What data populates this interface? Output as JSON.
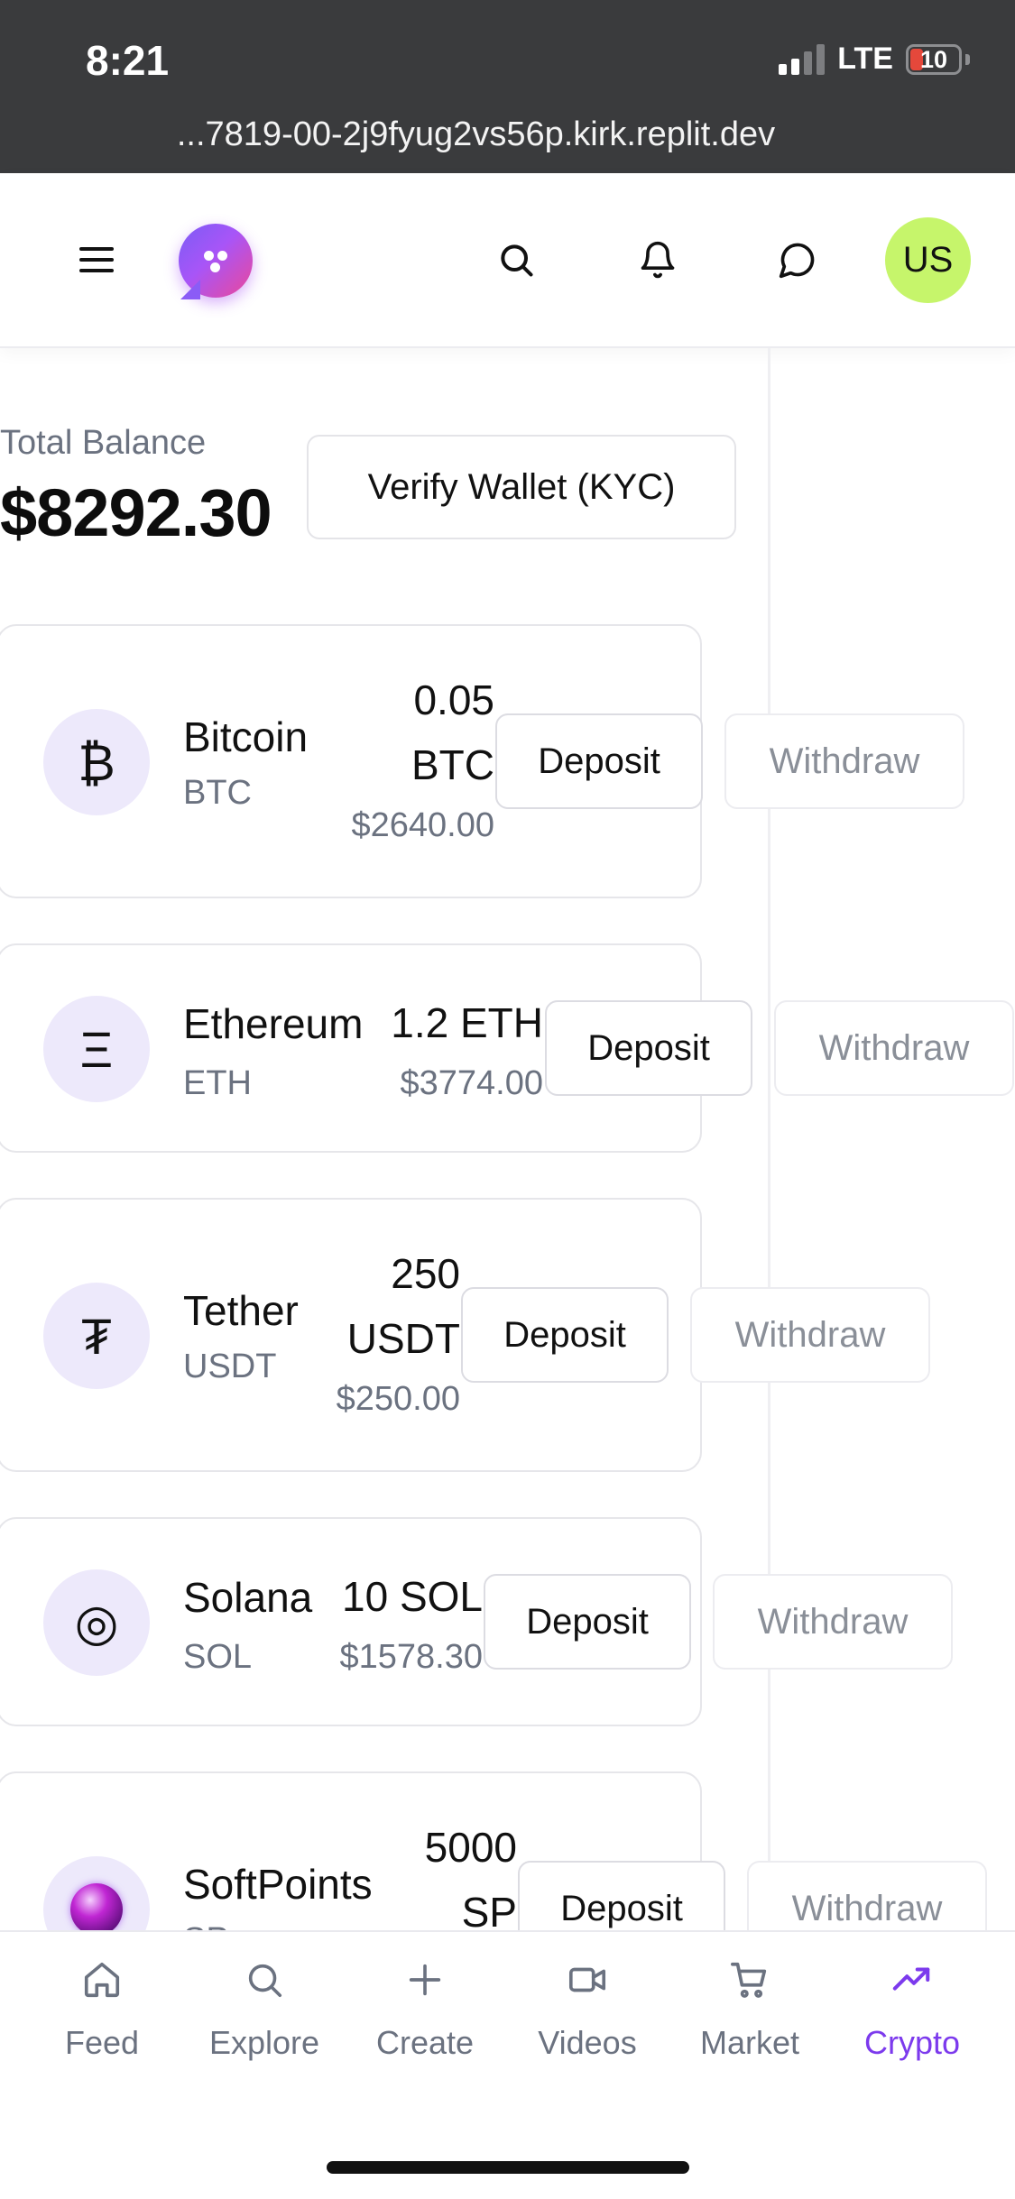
{
  "status_bar": {
    "time": "8:21",
    "network": "LTE",
    "battery": "10",
    "url": "...7819-00-2j9fyug2vs56p.kirk.replit.dev"
  },
  "header": {
    "menu_icon": "hamburger-icon",
    "logo_icon": "chat-bubble-logo",
    "search_icon": "search-icon",
    "notifications_icon": "bell-icon",
    "messages_icon": "message-circle-icon",
    "avatar_initials": "US",
    "avatar_color": "#c6f56b"
  },
  "wallet": {
    "balance_label": "Total Balance",
    "balance_value": "$8292.30",
    "kyc_button": "Verify Wallet (KYC)"
  },
  "assets": [
    {
      "name": "Bitcoin",
      "symbol": "BTC",
      "icon": "₿",
      "amount_line1": "0.05",
      "amount_line2": "BTC",
      "fiat": "$2640.00",
      "deposit": "Deposit",
      "withdraw": "Withdraw"
    },
    {
      "name": "Ethereum",
      "symbol": "ETH",
      "icon": "Ξ",
      "amount_line1": "1.2 ETH",
      "fiat": "$3774.00",
      "deposit": "Deposit",
      "withdraw": "Withdraw"
    },
    {
      "name": "Tether",
      "symbol": "USDT",
      "icon": "₮",
      "amount_line1": "250",
      "amount_line2": "USDT",
      "fiat": "$250.00",
      "deposit": "Deposit",
      "withdraw": "Withdraw"
    },
    {
      "name": "Solana",
      "symbol": "SOL",
      "icon": "◎",
      "amount_line1": "10 SOL",
      "fiat": "$1578.30",
      "deposit": "Deposit",
      "withdraw": "Withdraw"
    },
    {
      "name": "SoftPoints",
      "symbol": "SP",
      "icon": "purple-orb-icon",
      "amount_line1": "5000",
      "amount_line2": "SP",
      "deposit": "Deposit",
      "withdraw": "Withdraw"
    }
  ],
  "bottom_nav": {
    "active_color": "#7c3aed",
    "items": [
      {
        "label": "Feed",
        "icon": "home-icon"
      },
      {
        "label": "Explore",
        "icon": "search-icon"
      },
      {
        "label": "Create",
        "icon": "plus-icon"
      },
      {
        "label": "Videos",
        "icon": "video-icon"
      },
      {
        "label": "Market",
        "icon": "shopping-cart-icon"
      },
      {
        "label": "Crypto",
        "icon": "trending-up-icon",
        "active": true
      }
    ]
  }
}
